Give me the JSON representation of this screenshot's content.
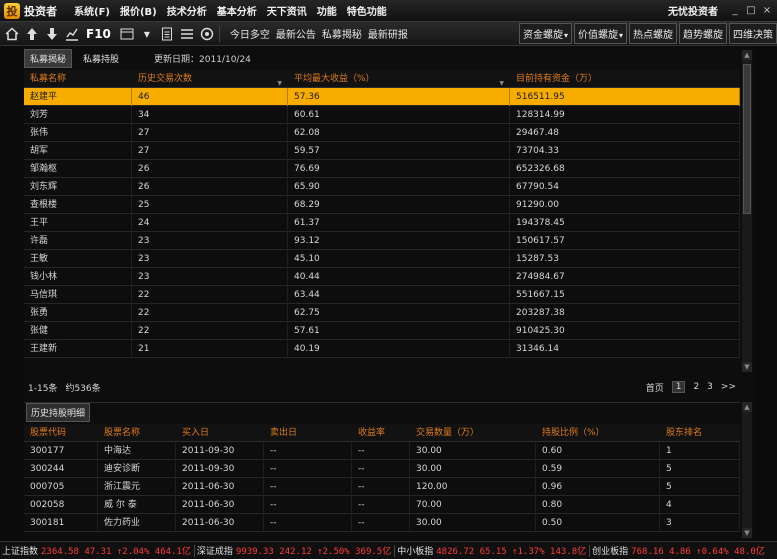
{
  "app": {
    "logo_glyph": "投",
    "logo_text": "投资者",
    "user": "无忧投资者"
  },
  "menu": [
    "系统(F)",
    "报价(B)",
    "技术分析",
    "基本分析",
    "天下资讯",
    "功能",
    "特色功能"
  ],
  "window_buttons": [
    "_",
    "□",
    "×"
  ],
  "toolbar": {
    "f10_label": "F10",
    "links": [
      "今日多空",
      "最新公告",
      "私募揭秘",
      "最新研报"
    ],
    "buttons": [
      "资金螺旋",
      "价值螺旋",
      "热点螺旋",
      "趋势螺旋",
      "四维决策"
    ]
  },
  "tabs": {
    "items": [
      "私募揭秘",
      "私募持股"
    ],
    "active_index": 0
  },
  "update_date": "更新日期：2011/10/24",
  "fund_table": {
    "columns": [
      "私募名称",
      "历史交易次数",
      "平均最大收益（%）",
      "目前持有资金（万）"
    ],
    "rows": [
      [
        "赵建平",
        "46",
        "57.36",
        "516511.95"
      ],
      [
        "刘芳",
        "34",
        "60.61",
        "128314.99"
      ],
      [
        "张伟",
        "27",
        "62.08",
        "29467.48"
      ],
      [
        "胡军",
        "27",
        "59.57",
        "73704.33"
      ],
      [
        "邹瀚枢",
        "26",
        "76.69",
        "652326.68"
      ],
      [
        "刘东辉",
        "26",
        "65.90",
        "67790.54"
      ],
      [
        "查根楼",
        "25",
        "68.29",
        "91290.00"
      ],
      [
        "王平",
        "24",
        "61.37",
        "194378.45"
      ],
      [
        "许磊",
        "23",
        "93.12",
        "150617.57"
      ],
      [
        "王敏",
        "23",
        "45.10",
        "15287.53"
      ],
      [
        "钱小林",
        "23",
        "40.44",
        "274984.67"
      ],
      [
        "马信琪",
        "22",
        "63.44",
        "551667.15"
      ],
      [
        "张勇",
        "22",
        "62.75",
        "203287.38"
      ],
      [
        "张健",
        "22",
        "57.61",
        "910425.30"
      ],
      [
        "王建新",
        "21",
        "40.19",
        "31346.14"
      ]
    ],
    "selected_index": 0
  },
  "pager": {
    "range_text": "1-15条",
    "total_text": "约536条",
    "first_label": "首页",
    "pages": [
      "1",
      "2",
      "3"
    ],
    "next_label": ">>",
    "current_page": "1"
  },
  "history_section": {
    "title": "历史持股明细"
  },
  "holdings_table": {
    "columns": [
      "股票代码",
      "股票名称",
      "买入日",
      "卖出日",
      "收益率",
      "交易数量（万）",
      "持股比例（%）",
      "股东排名"
    ],
    "rows": [
      [
        "300177",
        "中海达",
        "2011-09-30",
        "--",
        "--",
        "30.00",
        "0.60",
        "1"
      ],
      [
        "300244",
        "迪安诊断",
        "2011-09-30",
        "--",
        "--",
        "30.00",
        "0.59",
        "5"
      ],
      [
        "000705",
        "浙江震元",
        "2011-06-30",
        "--",
        "--",
        "120.00",
        "0.96",
        "5"
      ],
      [
        "002058",
        "威 尔 泰",
        "2011-06-30",
        "--",
        "--",
        "70.00",
        "0.80",
        "4"
      ],
      [
        "300181",
        "佐力药业",
        "2011-06-30",
        "--",
        "--",
        "30.00",
        "0.50",
        "3"
      ]
    ]
  },
  "statusbar": [
    {
      "name": "上证指数",
      "value": "2364.58 47.31 ↑2.04% 464.1亿"
    },
    {
      "name": "深证成指",
      "value": "9939.33 242.12 ↑2.50% 369.5亿"
    },
    {
      "name": "中小板指",
      "value": "4826.72 65.15 ↑1.37% 143.8亿"
    },
    {
      "name": "创业板指",
      "value": "768.16 4.86 ↑0.64% 48.0亿"
    }
  ],
  "colors": {
    "accent": "#f6ad00",
    "header_text": "#e07b1a",
    "up": "#ff3b3b",
    "background": "#0d0d0d"
  }
}
